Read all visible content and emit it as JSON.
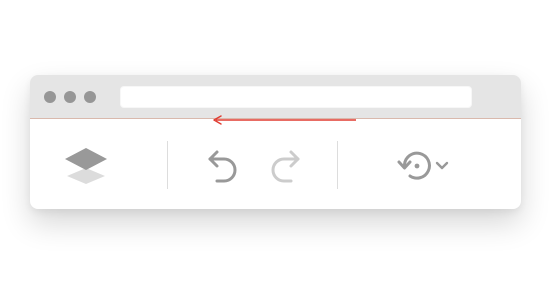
{
  "window": {
    "address_bar": {
      "value": ""
    }
  },
  "toolbar": {
    "tools": [
      {
        "name": "layers",
        "icon": "layers-icon"
      },
      {
        "name": "undo",
        "icon": "undo-icon",
        "state": "enabled"
      },
      {
        "name": "redo",
        "icon": "redo-icon",
        "state": "disabled"
      },
      {
        "name": "history",
        "icon": "history-icon",
        "has_dropdown": true
      }
    ]
  },
  "annotation": {
    "type": "arrow",
    "from": "history",
    "to": "undo",
    "color": "#e03c31"
  },
  "colors": {
    "titlebar": "#e5e5e5",
    "window_dots": "#969696",
    "icon_active": "#999999",
    "icon_disabled": "#cccccc",
    "annotation_arrow": "#e03c31"
  }
}
